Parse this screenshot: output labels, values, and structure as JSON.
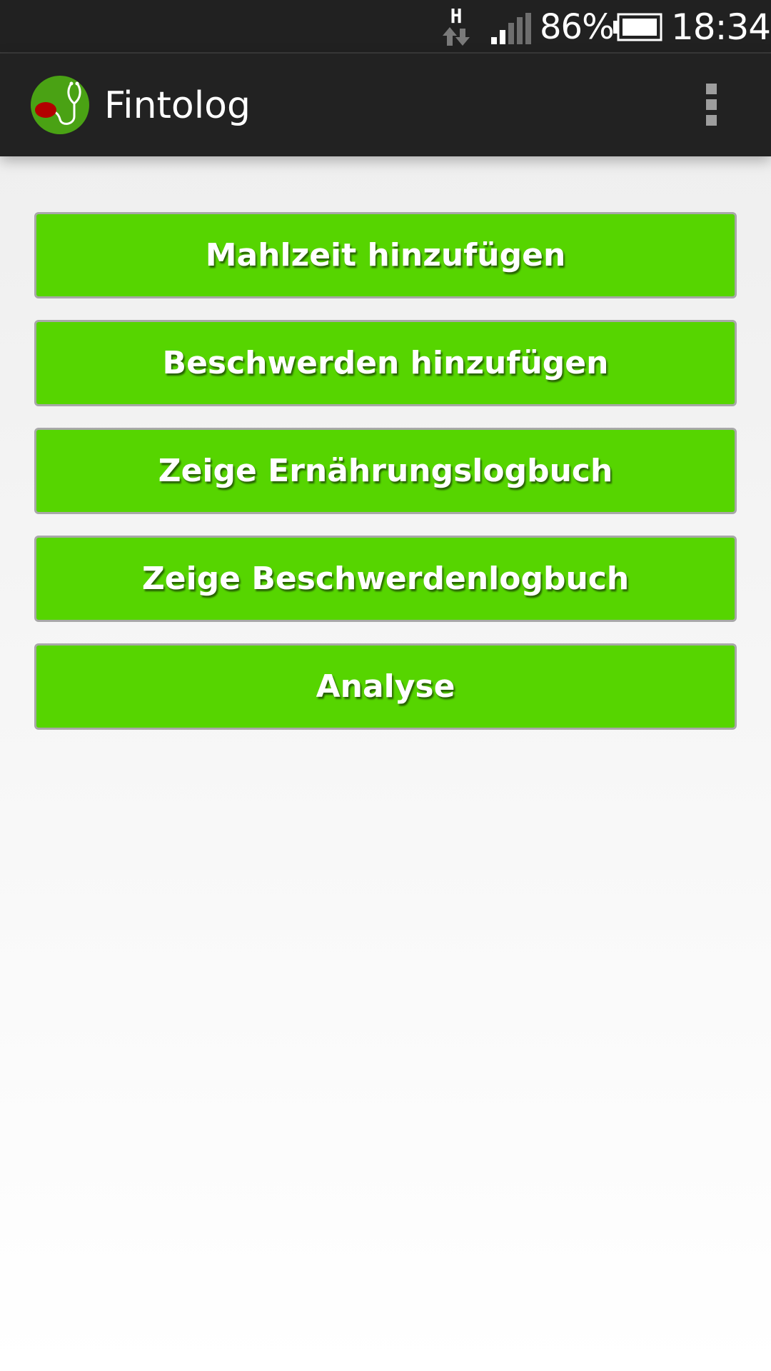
{
  "status_bar": {
    "network_type": "H",
    "battery_percent": "86%",
    "time": "18:34",
    "icons": [
      "network-hspa-icon",
      "signal-strength-icon",
      "battery-icon"
    ]
  },
  "action_bar": {
    "title": "Fintolog",
    "logo_icon": "stethoscope-logo-icon",
    "menu_icon": "overflow-menu-icon"
  },
  "main": {
    "buttons": [
      {
        "label": "Mahlzeit hinzufügen"
      },
      {
        "label": "Beschwerden hinzufügen"
      },
      {
        "label": "Zeige Ernährungslogbuch"
      },
      {
        "label": "Zeige Beschwerdenlogbuch"
      },
      {
        "label": "Analyse"
      }
    ]
  },
  "colors": {
    "button_green": "#56d500",
    "button_border": "#a8a8a8",
    "bar_dark": "#222222",
    "logo_green": "#4aa214",
    "logo_red": "#b30000"
  }
}
